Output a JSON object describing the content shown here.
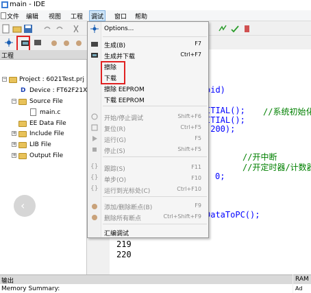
{
  "window": {
    "title": "main - IDE"
  },
  "menubar": [
    "文件",
    "编辑",
    "视图",
    "工程",
    "调试",
    "窗口",
    "帮助"
  ],
  "project_panel": {
    "header": "工程",
    "tree": [
      {
        "label": "Project : 6021Test.prj"
      },
      {
        "label": "Device : FT62F21X"
      },
      {
        "label": "Source File"
      },
      {
        "label": "main.c"
      },
      {
        "label": "EE Data File"
      },
      {
        "label": "Include File"
      },
      {
        "label": "LIB File"
      },
      {
        "label": "Output File"
      }
    ]
  },
  "editor": {
    "lines": [
      {
        "text": "oid)"
      },
      {
        "text": "ITIAL();"
      },
      {
        "text": "//系统初始化"
      },
      {
        "text": "ITIAL();"
      },
      {
        "text": "(200);"
      },
      {
        "text": "//开中断"
      },
      {
        "text": "//开定时器/计数器"
      },
      {
        "text": "0;"
      },
      {
        "text": "DataToPC();"
      }
    ],
    "line_numbers": [
      "219",
      "220"
    ]
  },
  "debug_menu": {
    "items": [
      {
        "label": "Options...",
        "shortcut": "",
        "enabled": true,
        "icon": "options-icon"
      },
      {
        "label": "生成(B)",
        "shortcut": "F7",
        "enabled": true,
        "icon": "build-icon"
      },
      {
        "label": "生成并下载",
        "shortcut": "Ctrl+F7",
        "enabled": true,
        "icon": "build-download-icon"
      },
      {
        "label": "擦除",
        "shortcut": "",
        "enabled": true,
        "icon": ""
      },
      {
        "label": "下载",
        "shortcut": "",
        "enabled": true,
        "icon": ""
      },
      {
        "label": "擦除 EEPROM",
        "shortcut": "",
        "enabled": true,
        "icon": ""
      },
      {
        "label": "下载 EEPROM",
        "shortcut": "",
        "enabled": true,
        "icon": ""
      },
      {
        "label": "开始/停止调试",
        "shortcut": "Shift+F6",
        "enabled": false,
        "icon": "debug-start-icon"
      },
      {
        "label": "复位(R)",
        "shortcut": "Ctrl+F5",
        "enabled": false,
        "icon": "reset-icon"
      },
      {
        "label": "运行(G)",
        "shortcut": "F5",
        "enabled": false,
        "icon": "run-icon"
      },
      {
        "label": "停止(S)",
        "shortcut": "Shift+F5",
        "enabled": false,
        "icon": "stop-icon"
      },
      {
        "label": "跟踪(S)",
        "shortcut": "F11",
        "enabled": false,
        "icon": "step-into-icon"
      },
      {
        "label": "单步(O)",
        "shortcut": "F10",
        "enabled": false,
        "icon": "step-over-icon"
      },
      {
        "label": "运行到光标处(C)",
        "shortcut": "Ctrl+F10",
        "enabled": false,
        "icon": "run-to-cursor-icon"
      },
      {
        "label": "添加/删除断点(B)",
        "shortcut": "F9",
        "enabled": false,
        "icon": "breakpoint-icon"
      },
      {
        "label": "删除所有断点",
        "shortcut": "Ctrl+Shift+F9",
        "enabled": false,
        "icon": "clear-breakpoints-icon"
      },
      {
        "label": "汇编调试",
        "shortcut": "",
        "enabled": true,
        "icon": ""
      }
    ]
  },
  "bottom_panel": {
    "header": "输出",
    "content": "Memory Summary:"
  },
  "ram_panel": {
    "header": "RAM",
    "content": "Ad"
  },
  "colors": {
    "highlight": "#e02020",
    "menu_active": "#cde4f7",
    "keyword": "#0000ff",
    "comment": "#008000"
  }
}
